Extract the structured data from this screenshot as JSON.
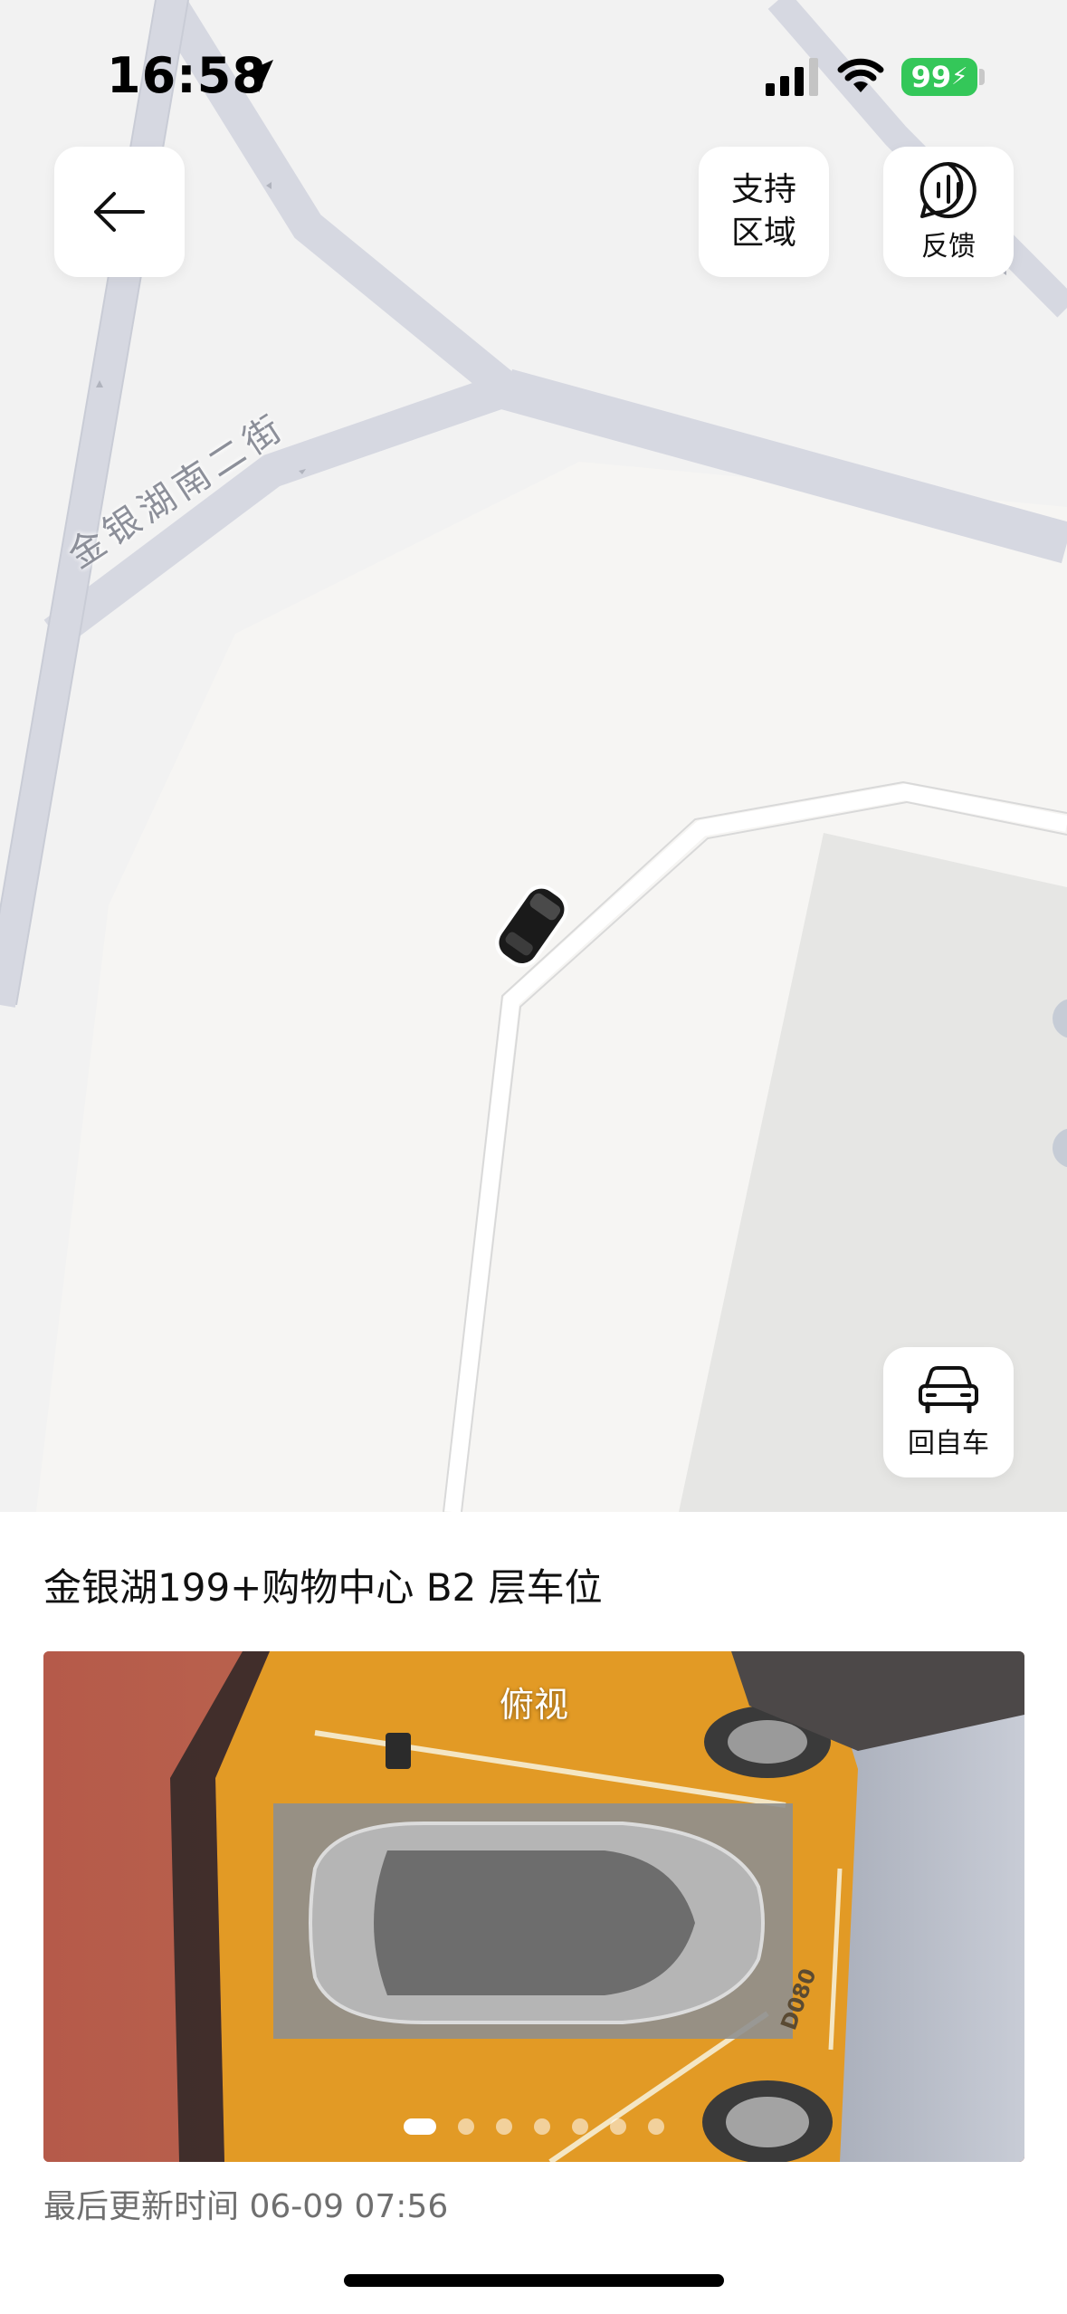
{
  "status_bar": {
    "time": "16:58",
    "battery": "99"
  },
  "map": {
    "street_name": "金银湖南二街",
    "support_area_line1": "支持",
    "support_area_line2": "区域",
    "feedback_label": "反馈",
    "return_to_car_label": "回自车"
  },
  "parking": {
    "location_title": "金银湖199+购物中心 B2 层车位",
    "view_label": "俯视",
    "slot_number": "D080",
    "photo_page_count": 7,
    "photo_active_page": 1,
    "last_updated": "最后更新时间 06-09 07:56"
  },
  "icons": {
    "back": "arrow-left-icon",
    "feedback": "feedback-waveform-icon",
    "return_to_car": "car-front-icon",
    "location": "location-arrow-icon",
    "signal": "cellular-signal-icon",
    "wifi": "wifi-icon"
  },
  "colors": {
    "battery": "#34c759",
    "map_background": "#f5f5f5",
    "road": "#d9dbe3",
    "parking_floor": "#e8a52a"
  }
}
